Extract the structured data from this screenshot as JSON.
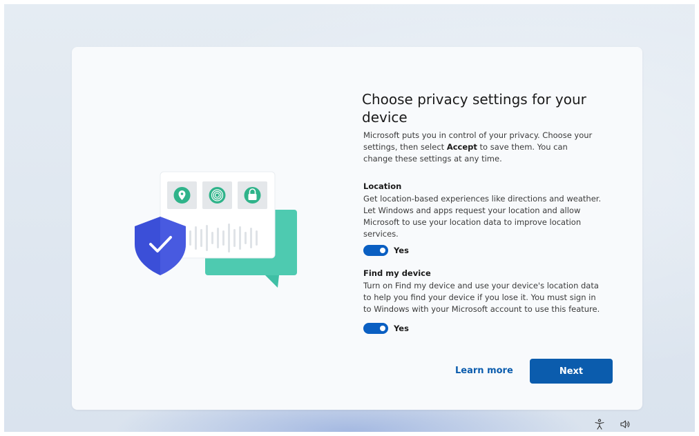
{
  "page": {
    "title": "Choose privacy settings for your device",
    "description_prefix": "Microsoft puts you in control of your privacy. Choose your settings, then select ",
    "description_bold": "Accept",
    "description_suffix": " to save them. You can change these settings at any time."
  },
  "settings": [
    {
      "title": "Location",
      "description": "Get location-based experiences like directions and weather. Let Windows and apps request your location and allow Microsoft to use your location data to improve location services.",
      "toggle_on": true,
      "toggle_label": "Yes"
    },
    {
      "title": "Find my device",
      "description": "Turn on Find my device and use your device's location data to help you find your device if you lose it. You must sign in to Windows with your Microsoft account to use this feature.",
      "toggle_on": true,
      "toggle_label": "Yes"
    }
  ],
  "actions": {
    "learn_more": "Learn more",
    "next": "Next"
  },
  "tray": {
    "accessibility_icon": "accessibility-icon",
    "volume_icon": "volume-icon"
  },
  "colors": {
    "accent": "#0b5cad",
    "toggle": "#0a5fc2",
    "shield": "#3b4fd8",
    "chat": "#4fc9b0"
  }
}
